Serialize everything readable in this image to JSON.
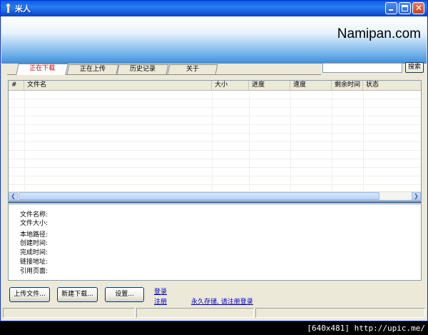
{
  "window": {
    "title": "米人"
  },
  "banner": {
    "brand": "Namipan.com"
  },
  "tabs": [
    {
      "label": "正在下载",
      "active": true
    },
    {
      "label": "正在上传",
      "active": false
    },
    {
      "label": "历史记录",
      "active": false
    },
    {
      "label": "关于",
      "active": false
    }
  ],
  "search": {
    "value": "",
    "button_label": "搜索"
  },
  "list": {
    "columns": [
      "#",
      "文件名",
      "大小",
      "进度",
      "速度",
      "剩余时间",
      "状态"
    ],
    "rows": []
  },
  "details": {
    "labels": [
      "文件名称:",
      "文件大小:",
      "本地路径:",
      "创建时间:",
      "完成时间:",
      "链接地址:",
      "引用页面:"
    ]
  },
  "actions": {
    "upload_label": "上传文件...",
    "new_download_label": "新建下载...",
    "settings_label": "设置..."
  },
  "links": {
    "login": "登录",
    "register": "注册",
    "promo": "永久存储, 请注册登录"
  },
  "watermark": "[640x481] http://upic.me/",
  "colors": {
    "titlebar": "#0a5fe8",
    "active_tab_text": "#d00000",
    "link": "#0000cc",
    "divider": "#2b5fb5"
  }
}
